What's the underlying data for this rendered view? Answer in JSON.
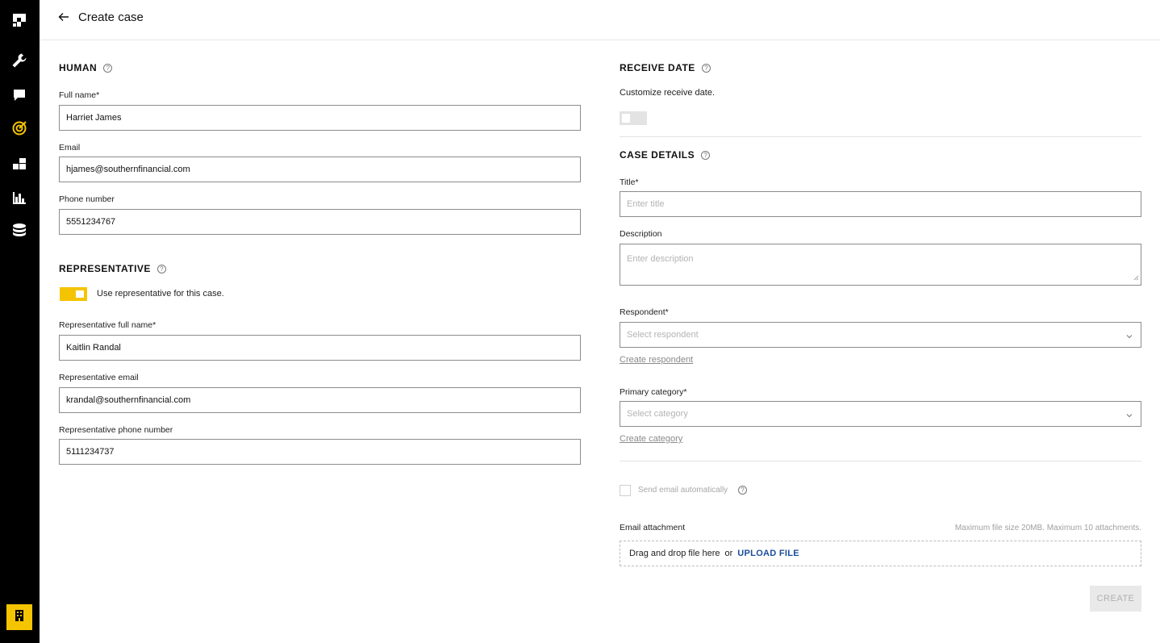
{
  "header": {
    "title": "Create case"
  },
  "human": {
    "section_title": "HUMAN",
    "full_name_label": "Full name*",
    "full_name_value": "Harriet James",
    "email_label": "Email",
    "email_value": "hjames@southernfinancial.com",
    "phone_label": "Phone number",
    "phone_value": "5551234767"
  },
  "representative": {
    "section_title": "REPRESENTATIVE",
    "toggle_label": "Use representative for this case.",
    "toggle_on": true,
    "full_name_label": "Representative full name*",
    "full_name_value": "Kaitlin Randal",
    "email_label": "Representative email",
    "email_value": "krandal@southernfinancial.com",
    "phone_label": "Representative phone number",
    "phone_value": "5111234737"
  },
  "receive_date": {
    "section_title": "RECEIVE DATE",
    "description": "Customize receive date.",
    "toggle_on": false
  },
  "case_details": {
    "section_title": "CASE DETAILS",
    "title_label": "Title*",
    "title_placeholder": "Enter title",
    "description_label": "Description",
    "description_placeholder": "Enter description",
    "respondent_label": "Respondent*",
    "respondent_placeholder": "Select respondent",
    "create_respondent_link": "Create respondent",
    "category_label": "Primary category*",
    "category_placeholder": "Select category",
    "create_category_link": "Create category"
  },
  "email": {
    "send_auto_label": "Send email automatically",
    "attachment_label": "Email attachment",
    "attachment_hint": "Maximum file size 20MB. Maximum 10 attachments.",
    "dropzone_text": "Drag and drop file here",
    "dropzone_or": "or",
    "upload_label": "UPLOAD FILE"
  },
  "actions": {
    "create_label": "CREATE"
  },
  "colors": {
    "accent": "#f5c400",
    "sidebar": "#000000",
    "link": "#1a4d9c"
  },
  "sidebar_icons": [
    "logo-icon",
    "wrench-icon",
    "chat-icon",
    "target-icon",
    "boxes-icon",
    "bar-chart-icon",
    "database-icon",
    "building-icon"
  ]
}
